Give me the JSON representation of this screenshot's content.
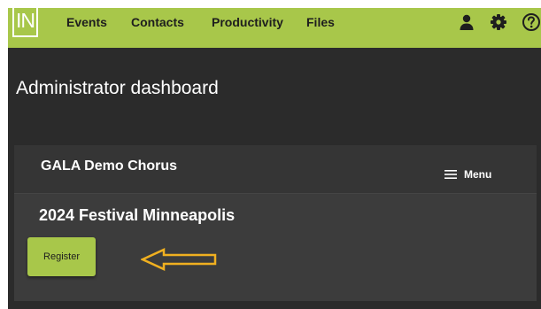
{
  "nav": {
    "logo": "IN",
    "items": [
      {
        "label": "Events"
      },
      {
        "label": "Contacts"
      },
      {
        "label": "Productivity"
      },
      {
        "label": "Files"
      }
    ],
    "icons": [
      "user-icon",
      "gear-icon",
      "help-icon"
    ]
  },
  "page": {
    "title": "Administrator dashboard"
  },
  "card": {
    "org_name": "GALA Demo Chorus",
    "menu_label": "Menu",
    "event_title": "2024 Festival Minneapolis",
    "register_label": "Register"
  },
  "colors": {
    "brand_green": "#a8c74a",
    "background": "#2b2b2b",
    "card": "#3c3c3c",
    "arrow": "#f0b020"
  }
}
